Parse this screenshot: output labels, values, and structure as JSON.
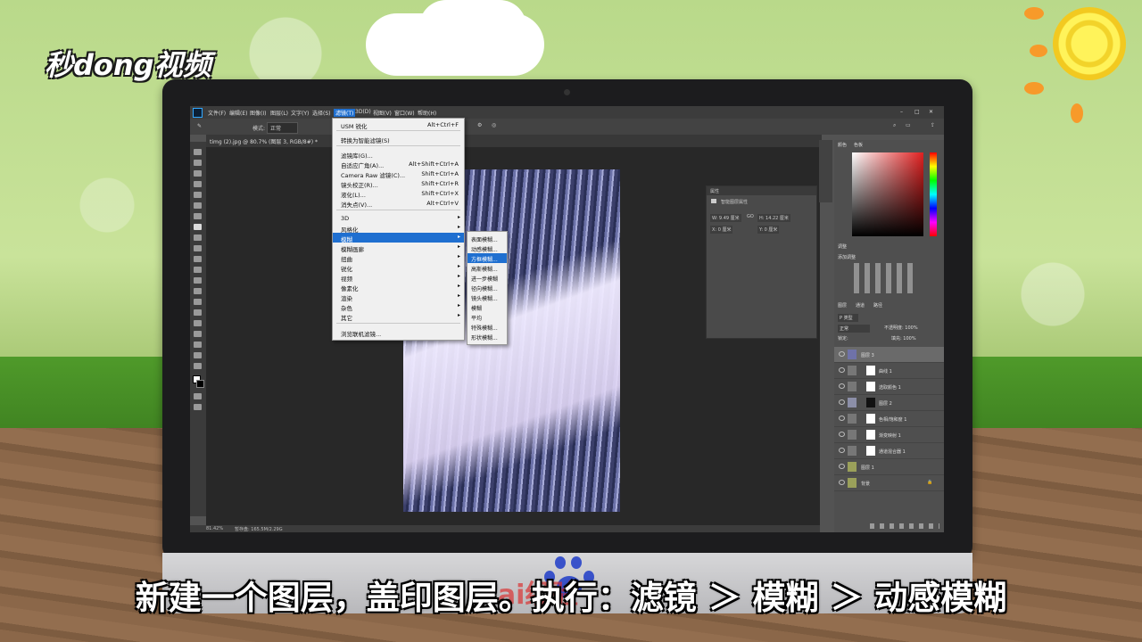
{
  "overlay": {
    "logo_text": "秒dong视频",
    "caption": "新建一个图层，盖印图层。执行：滤镜 ＞ 模糊 ＞ 动感模糊",
    "watermark": "Bai经验"
  },
  "ps": {
    "menubar": [
      "文件(F)",
      "编辑(E)",
      "图像(I)",
      "图层(L)",
      "文字(Y)",
      "选择(S)",
      "滤镜(T)",
      "3D(D)",
      "视图(V)",
      "窗口(W)",
      "帮助(H)"
    ],
    "options_mode_label": "模式:",
    "options_mode_value": "正常",
    "doc_tab": "timg (2).jpg @ 80.7% (图层 3, RGB/8#) *",
    "zoom_status": "81.42%",
    "doc_status": "暂存盘: 165.5M/2.29G"
  },
  "filter_menu": {
    "items": [
      {
        "label": "USM 锐化",
        "shortcut": "Alt+Ctrl+F"
      },
      {
        "label": "转换为智能滤镜(S)",
        "shortcut": ""
      },
      {
        "label": "滤镜库(G)...",
        "shortcut": ""
      },
      {
        "label": "自适应广角(A)...",
        "shortcut": "Alt+Shift+Ctrl+A"
      },
      {
        "label": "Camera Raw 滤镜(C)...",
        "shortcut": "Shift+Ctrl+A"
      },
      {
        "label": "镜头校正(R)...",
        "shortcut": "Shift+Ctrl+R"
      },
      {
        "label": "液化(L)...",
        "shortcut": "Shift+Ctrl+X"
      },
      {
        "label": "消失点(V)...",
        "shortcut": "Alt+Ctrl+V"
      },
      {
        "label": "3D",
        "shortcut": ""
      },
      {
        "label": "风格化",
        "shortcut": ""
      },
      {
        "label": "模糊",
        "shortcut": ""
      },
      {
        "label": "模糊画廊",
        "shortcut": ""
      },
      {
        "label": "扭曲",
        "shortcut": ""
      },
      {
        "label": "锐化",
        "shortcut": ""
      },
      {
        "label": "视频",
        "shortcut": ""
      },
      {
        "label": "像素化",
        "shortcut": ""
      },
      {
        "label": "渲染",
        "shortcut": ""
      },
      {
        "label": "杂色",
        "shortcut": ""
      },
      {
        "label": "其它",
        "shortcut": ""
      },
      {
        "label": "浏览联机滤镜...",
        "shortcut": ""
      }
    ]
  },
  "blur_submenu": {
    "items": [
      "表面模糊...",
      "动感模糊...",
      "方框模糊...",
      "高斯模糊...",
      "进一步模糊",
      "径向模糊...",
      "镜头模糊...",
      "模糊",
      "平均",
      "特殊模糊...",
      "形状模糊..."
    ],
    "highlighted_index": 2
  },
  "properties_panel": {
    "title": "属性",
    "subtitle": "智能图层属性",
    "w": "W: 9.49 厘米",
    "go": "GO",
    "h": "H: 14.22 厘米",
    "x": "X: 0 厘米",
    "y": "Y: 0 厘米"
  },
  "right_panels": {
    "color_tabs": [
      "颜色",
      "色板"
    ],
    "adjust_title": "调整",
    "adjust_sub": "添加调整",
    "layers_tabs": [
      "图层",
      "通道",
      "路径"
    ],
    "kind_label": "P 类型",
    "blend_mode": "正常",
    "opacity": "不透明度: 100%",
    "lock_label": "锁定:",
    "fill": "填充: 100%",
    "layers": [
      {
        "name": "图层 3",
        "selected": true
      },
      {
        "name": "曲线 1",
        "selected": false
      },
      {
        "name": "选取颜色 1",
        "selected": false
      },
      {
        "name": "图层 2",
        "selected": false
      },
      {
        "name": "色相/饱和度 1",
        "selected": false
      },
      {
        "name": "渐变映射 1",
        "selected": false
      },
      {
        "name": "通道混合器 1",
        "selected": false
      },
      {
        "name": "图层 1",
        "selected": false
      },
      {
        "name": "背景",
        "selected": false
      }
    ]
  }
}
